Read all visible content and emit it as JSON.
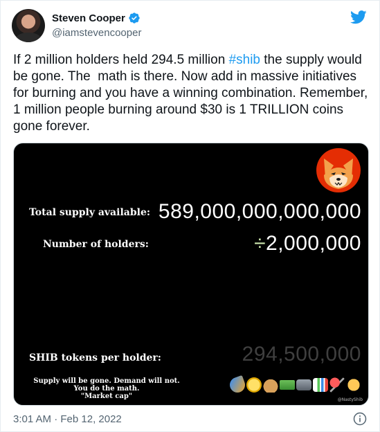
{
  "author": {
    "name": "Steven Cooper",
    "handle": "@iamstevencooper",
    "verified": true
  },
  "tweet": {
    "text_before": "If 2 million holders held 294.5 million ",
    "hashtag": "#shib",
    "text_after": " the supply would be gone. The  math is there. Now add in massive initiatives for burning and you have a winning combination. Remember, 1 million people burning around $30 is 1 TRILLION coins gone forever.",
    "timestamp": "3:01 AM · Feb 12, 2022"
  },
  "media": {
    "total_supply_label": "Total supply available:",
    "total_supply_value": "589,000,000,000,000",
    "holders_label": "Number of holders:",
    "holders_divide_symbol": "÷",
    "holders_value": "2,000,000",
    "per_holder_label": "SHIB tokens per holder:",
    "per_holder_value": "294,500,000",
    "note_line1": "Supply will be gone. Demand will not.",
    "note_line2": "You do the math.",
    "note_line3": "\"Market cap\"",
    "watermark": "@NastyShib",
    "emojis": [
      "rocket",
      "coin",
      "money-bag",
      "cash",
      "inbox-tray",
      "bar-chart",
      "pushpin",
      "handshake"
    ]
  },
  "colors": {
    "brand_blue": "#1d9bf0",
    "text": "#0f1419",
    "secondary_text": "#536471",
    "media_bg": "#000000"
  },
  "icons": {
    "twitter": "twitter-bird-icon",
    "verified": "verified-badge-icon",
    "info": "info-icon",
    "shiba": "shiba-inu-logo"
  }
}
